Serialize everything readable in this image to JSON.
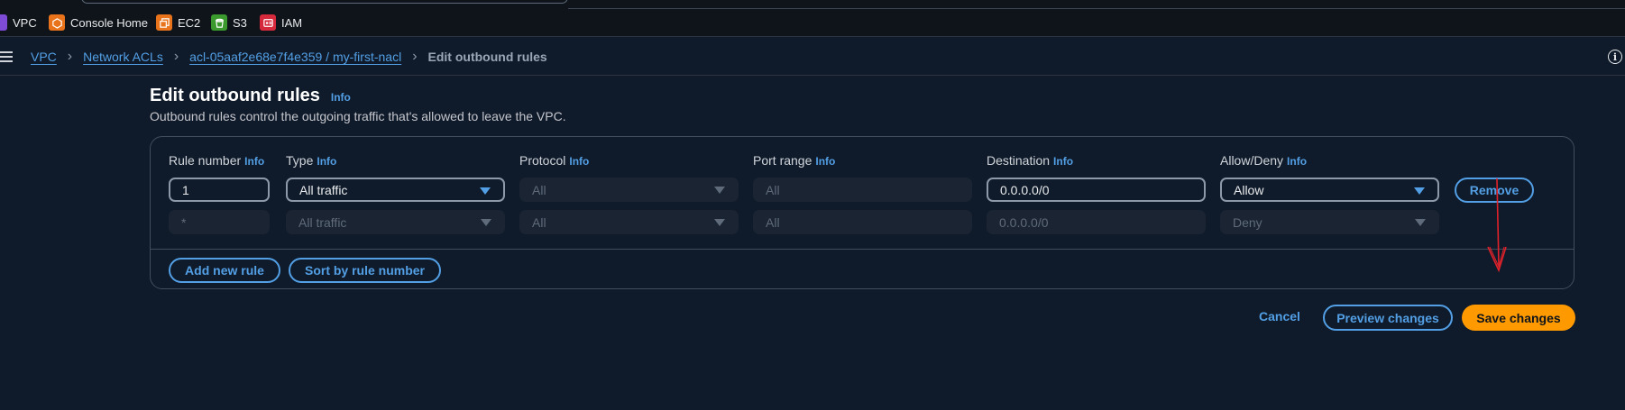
{
  "favorites": [
    {
      "label": "VPC",
      "icon": "vpc-icon",
      "color": "#7d4bd6"
    },
    {
      "label": "Console Home",
      "icon": "console-home-icon",
      "color": "#e8731a"
    },
    {
      "label": "EC2",
      "icon": "ec2-icon",
      "color": "#e8731a"
    },
    {
      "label": "S3",
      "icon": "s3-icon",
      "color": "#3a9a2e"
    },
    {
      "label": "IAM",
      "icon": "iam-icon",
      "color": "#d6293b"
    }
  ],
  "breadcrumb": {
    "items": [
      "VPC",
      "Network ACLs",
      "acl-05aaf2e68e7f4e359 / my-first-nacl"
    ],
    "current": "Edit outbound rules"
  },
  "page": {
    "title": "Edit outbound rules",
    "title_info": "Info",
    "description": "Outbound rules control the outgoing traffic that's allowed to leave the VPC."
  },
  "columns": [
    {
      "label": "Rule number",
      "info": "Info"
    },
    {
      "label": "Type",
      "info": "Info"
    },
    {
      "label": "Protocol",
      "info": "Info"
    },
    {
      "label": "Port range",
      "info": "Info"
    },
    {
      "label": "Destination",
      "info": "Info"
    },
    {
      "label": "Allow/Deny",
      "info": "Info"
    }
  ],
  "rules": [
    {
      "rule_number": "1",
      "type": "All traffic",
      "protocol": "All",
      "port_range": "All",
      "destination": "0.0.0.0/0",
      "allow_deny": "Allow",
      "remove_label": "Remove"
    },
    {
      "rule_number": "*",
      "type": "All traffic",
      "protocol": "All",
      "port_range": "All",
      "destination": "0.0.0.0/0",
      "allow_deny": "Deny"
    }
  ],
  "actions": {
    "add_rule": "Add new rule",
    "sort": "Sort by rule number",
    "cancel": "Cancel",
    "preview": "Preview changes",
    "save": "Save changes"
  },
  "colors": {
    "accent": "#539fe5",
    "primary": "#ff9900",
    "annotation": "#e0222b"
  }
}
